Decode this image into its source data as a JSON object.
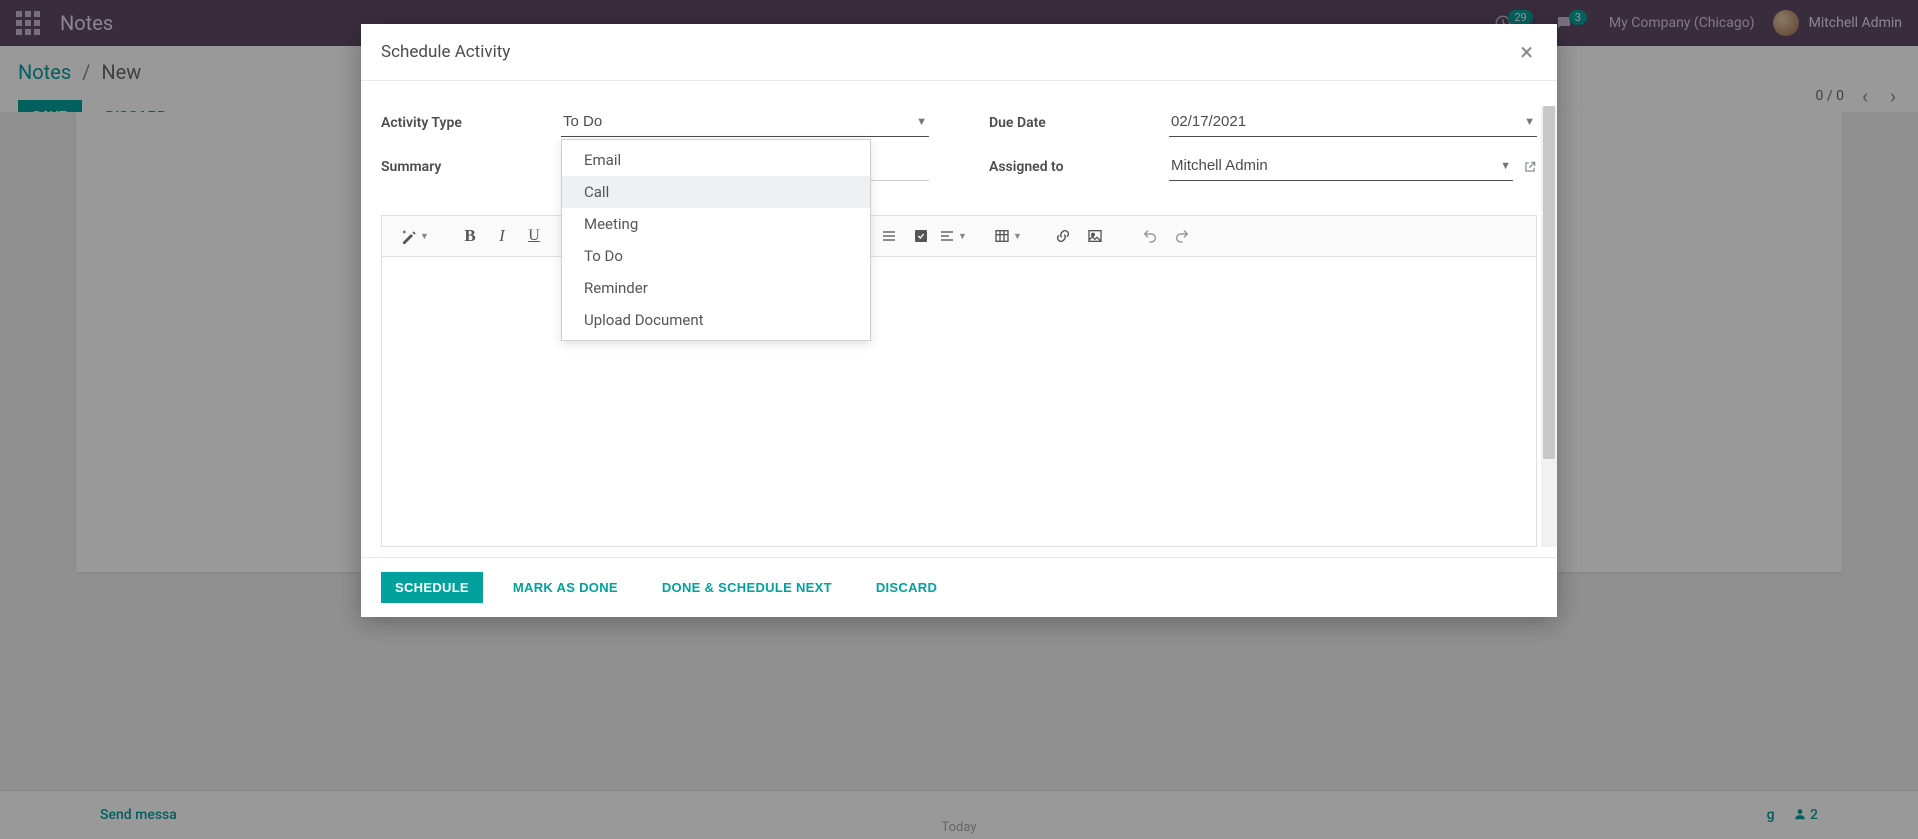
{
  "navbar": {
    "title": "Notes",
    "clock_badge": "29",
    "chat_badge": "3",
    "company": "My Company (Chicago)",
    "user": "Mitchell Admin"
  },
  "breadcrumb": {
    "root": "Notes",
    "current": "New"
  },
  "actions": {
    "save": "Save",
    "discard": "Discard"
  },
  "pager": {
    "count": "0 / 0"
  },
  "bottombar": {
    "send": "Send messa",
    "following": "g",
    "followers": "2",
    "today": "Today"
  },
  "modal": {
    "title": "Schedule Activity",
    "labels": {
      "activity_type": "Activity Type",
      "summary": "Summary",
      "due_date": "Due Date",
      "assigned_to": "Assigned to"
    },
    "values": {
      "activity_type": "To Do",
      "due_date": "02/17/2021",
      "assigned_to": "Mitchell Admin",
      "summary": ""
    },
    "dropdown": {
      "options": [
        {
          "label": "Email"
        },
        {
          "label": "Call"
        },
        {
          "label": "Meeting"
        },
        {
          "label": "To Do"
        },
        {
          "label": "Reminder"
        },
        {
          "label": "Upload Document"
        }
      ],
      "highlighted": "Call"
    },
    "footer": {
      "schedule": "Schedule",
      "mark_done": "Mark as Done",
      "done_next": "Done & Schedule Next",
      "discard": "Discard"
    }
  }
}
